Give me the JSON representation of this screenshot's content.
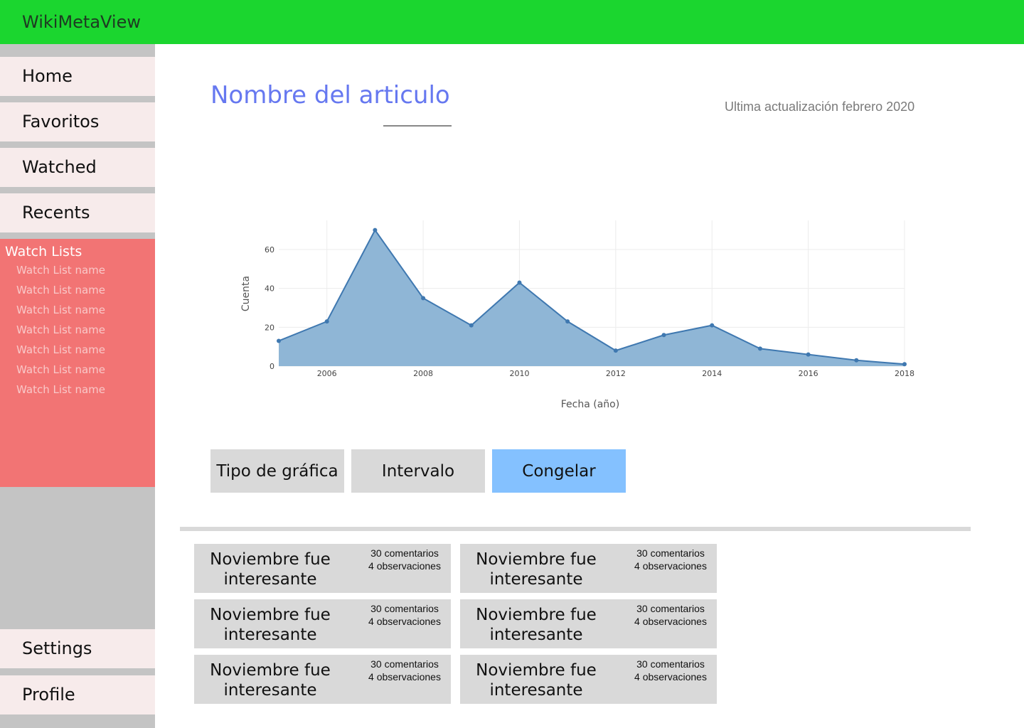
{
  "app": {
    "title": "WikiMetaView"
  },
  "sidebar": {
    "nav": [
      {
        "label": "Home"
      },
      {
        "label": "Favoritos"
      },
      {
        "label": "Watched"
      },
      {
        "label": "Recents"
      }
    ],
    "watch_lists": {
      "title": "Watch Lists",
      "items": [
        "Watch List name",
        "Watch List name",
        "Watch List name",
        "Watch List name",
        "Watch List name",
        "Watch List name",
        "Watch List name"
      ]
    },
    "bottom_nav": [
      {
        "label": "Settings"
      },
      {
        "label": "Profile"
      }
    ]
  },
  "article": {
    "title": "Nombre del articulo",
    "last_update": "Ultima actualización febrero 2020"
  },
  "chart_data": {
    "type": "area",
    "xlabel": "Fecha (año)",
    "ylabel": "Cuenta",
    "x": [
      2005,
      2006,
      2007,
      2008,
      2009,
      2010,
      2011,
      2012,
      2013,
      2014,
      2015,
      2016,
      2017,
      2018
    ],
    "y": [
      13,
      23,
      70,
      35,
      21,
      43,
      23,
      8,
      16,
      21,
      9,
      6,
      3,
      1
    ],
    "xlim": [
      2005,
      2018
    ],
    "ylim": [
      0,
      75
    ],
    "xticks": [
      2006,
      2008,
      2010,
      2012,
      2014,
      2016,
      2018
    ],
    "yticks": [
      0,
      20,
      40,
      60
    ],
    "grid": true,
    "fill_color": "#8fb6d6",
    "line_color": "#3f78b0"
  },
  "controls": {
    "chart_type": "Tipo de gráfica",
    "interval": "Intervalo",
    "freeze": "Congelar"
  },
  "cards": [
    {
      "title": "Noviembre fue interesante",
      "comments": "30 comentarios",
      "observations": "4 observaciones"
    },
    {
      "title": "Noviembre fue interesante",
      "comments": "30 comentarios",
      "observations": "4 observaciones"
    },
    {
      "title": "Noviembre fue interesante",
      "comments": "30 comentarios",
      "observations": "4 observaciones"
    },
    {
      "title": "Noviembre fue interesante",
      "comments": "30 comentarios",
      "observations": "4 observaciones"
    },
    {
      "title": "Noviembre fue interesante",
      "comments": "30 comentarios",
      "observations": "4 observaciones"
    },
    {
      "title": "Noviembre fue interesante",
      "comments": "30 comentarios",
      "observations": "4 observaciones"
    }
  ],
  "colors": {
    "topbar": "#1bd62f",
    "watch_panel": "#f27474",
    "accent_title": "#6678f0",
    "primary_button": "#84c1ff"
  }
}
